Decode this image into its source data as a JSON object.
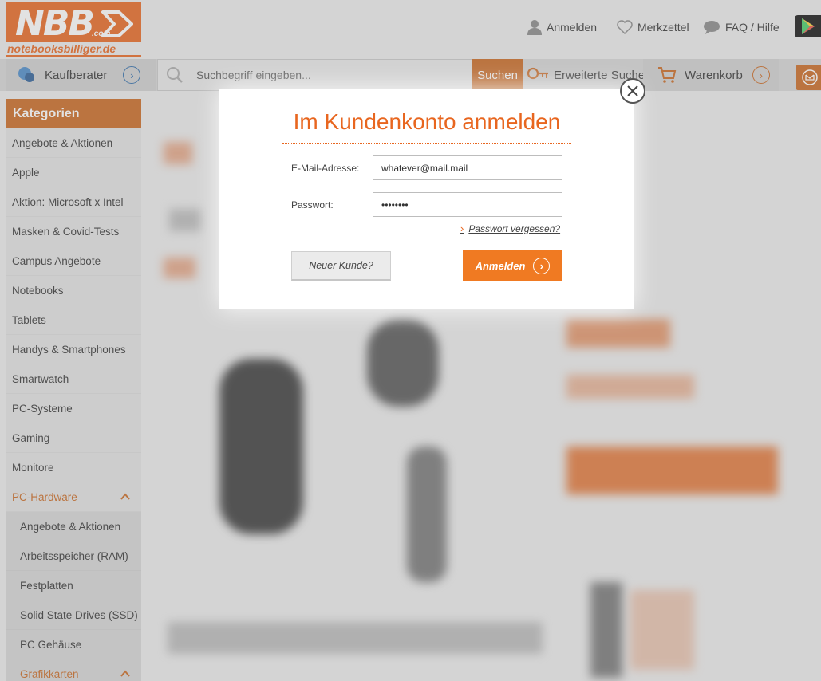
{
  "logo": {
    "brand": "NBB",
    "tld": ".com",
    "domain": "notebooksbilliger.de"
  },
  "topnav": {
    "login": "Anmelden",
    "wishlist": "Merkzettel",
    "faq": "FAQ / Hilfe"
  },
  "navbar": {
    "kaufberater": "Kaufberater",
    "search_placeholder": "Suchbegriff eingeben...",
    "search_button": "Suchen",
    "advanced_search": "Erweiterte Suche",
    "cart": "Warenkorb"
  },
  "sidebar": {
    "header": "Kategorien",
    "items": [
      "Angebote & Aktionen",
      "Apple",
      "Aktion: Microsoft x Intel",
      "Masken & Covid-Tests",
      "Campus Angebote",
      "Notebooks",
      "Tablets",
      "Handys & Smartphones",
      "Smartwatch",
      "PC-Systeme",
      "Gaming",
      "Monitore"
    ],
    "expanded": "PC-Hardware",
    "subitems": [
      "Angebote & Aktionen",
      "Arbeitsspeicher (RAM)",
      "Festplatten",
      "Solid State Drives (SSD)",
      "PC Gehäuse"
    ],
    "expanded_sub": "Grafikkarten"
  },
  "modal": {
    "title": "Im Kundenkonto anmelden",
    "email_label": "E-Mail-Adresse:",
    "email_value": "whatever@mail.mail",
    "password_label": "Passwort:",
    "password_value": "••••••••",
    "forgot_link": "Passwort vergessen?",
    "new_customer": "Neuer Kunde?",
    "login_button": "Anmelden"
  },
  "colors": {
    "accent": "#e8661f",
    "accent_dark": "#c9671f",
    "sidebar_bg": "#e2e2e2"
  }
}
